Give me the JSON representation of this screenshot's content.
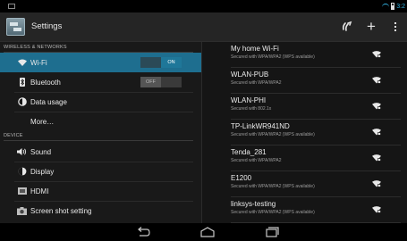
{
  "status_bar": {
    "time": "3:2",
    "notification_icon": "screenshot-notification-icon",
    "wifi_icon": "wifi-status-icon",
    "battery_icon": "battery-icon"
  },
  "action_bar": {
    "app_icon": "settings-app-icon",
    "title": "Settings",
    "wps_label": "ƒ ",
    "add_label": "+",
    "overflow_icon": "overflow-menu-icon"
  },
  "left_pane": {
    "sections": [
      {
        "header": "WIRELESS & NETWORKS"
      },
      {
        "header": "DEVICE"
      }
    ],
    "items": [
      {
        "label": "Wi-Fi",
        "icon": "wifi-icon",
        "toggle": "ON",
        "selected": true
      },
      {
        "label": "Bluetooth",
        "icon": "bluetooth-icon",
        "toggle": "OFF",
        "selected": false
      },
      {
        "label": "Data usage",
        "icon": "data-usage-icon"
      },
      {
        "label": "More…",
        "icon": ""
      },
      {
        "label": "Sound",
        "icon": "sound-icon"
      },
      {
        "label": "Display",
        "icon": "display-icon"
      },
      {
        "label": "HDMI",
        "icon": "hdmi-icon"
      },
      {
        "label": "Screen shot setting",
        "icon": "camera-icon"
      }
    ]
  },
  "networks": [
    {
      "name": "My home Wi-Fi",
      "security": "Secured with WPA/WPA2 (WPS available)",
      "locked": true
    },
    {
      "name": "WLAN-PUB",
      "security": "Secured with WPA/WPA2",
      "locked": true
    },
    {
      "name": "WLAN-PHI",
      "security": "Secured with 802.1x",
      "locked": true
    },
    {
      "name": "TP-LinkWR941ND",
      "security": "Secured with WPA/WPA2 (WPS available)",
      "locked": true
    },
    {
      "name": "Tenda_281",
      "security": "Secured with WPA/WPA2",
      "locked": true
    },
    {
      "name": "E1200",
      "security": "Secured with WPA/WPA2 (WPS available)",
      "locked": true
    },
    {
      "name": "linksys-testing",
      "security": "Secured with WPA/WPA2 (WPS available)",
      "locked": true
    }
  ],
  "nav_bar": {
    "back_icon": "back-icon",
    "home_icon": "home-icon",
    "recents_icon": "recent-apps-icon"
  },
  "colors": {
    "selected_bg": "#1e6e8f",
    "accent": "#33b5e5",
    "toggle_on": "#1f7799"
  }
}
